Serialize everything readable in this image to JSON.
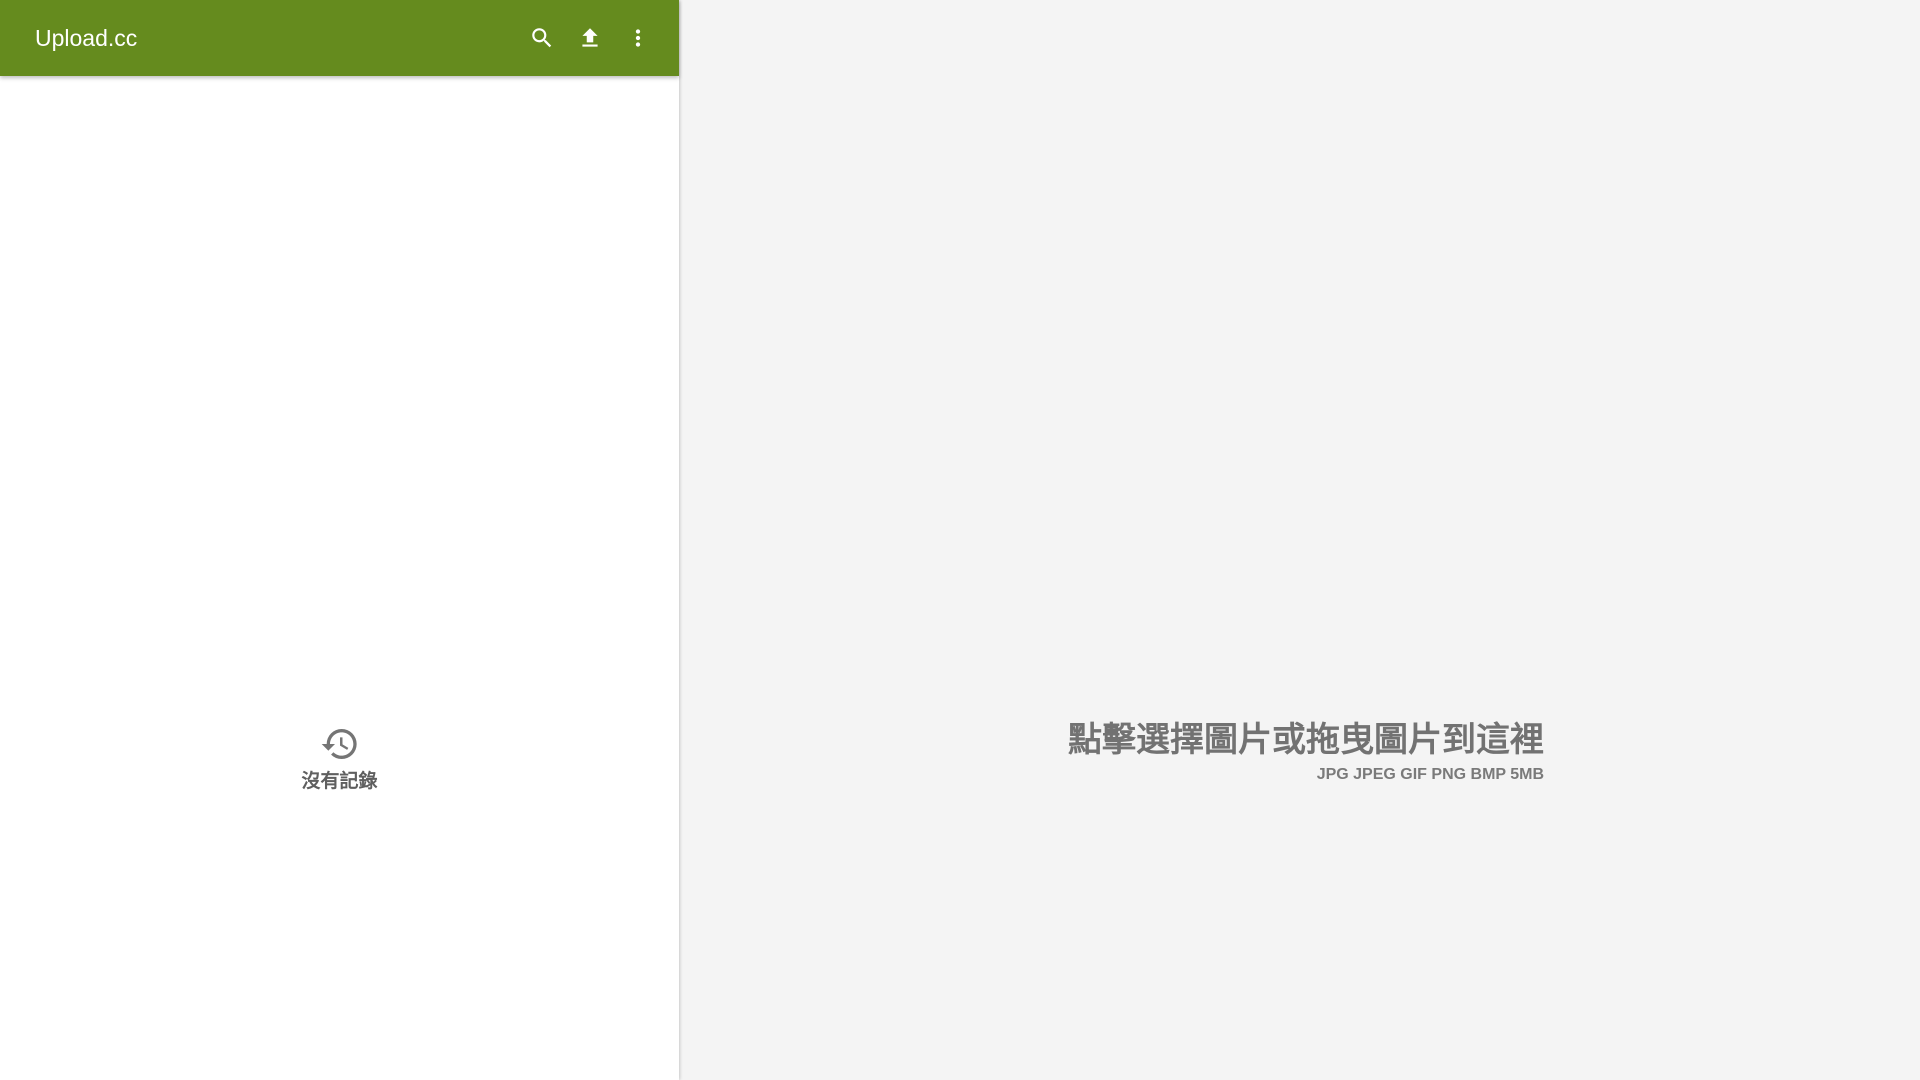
{
  "appbar": {
    "title": "Upload.cc",
    "color": "#658b1e",
    "actions": [
      {
        "icon": "search-icon"
      },
      {
        "icon": "upload-icon"
      },
      {
        "icon": "more-vert-icon"
      }
    ]
  },
  "history": {
    "icon": "history-icon",
    "empty_text": "沒有記錄"
  },
  "dropzone": {
    "title": "點擊選擇圖片或拖曳圖片到這裡",
    "formats": "JPG JPEG GIF PNG BMP 5MB",
    "background": "#f4f4f4"
  }
}
